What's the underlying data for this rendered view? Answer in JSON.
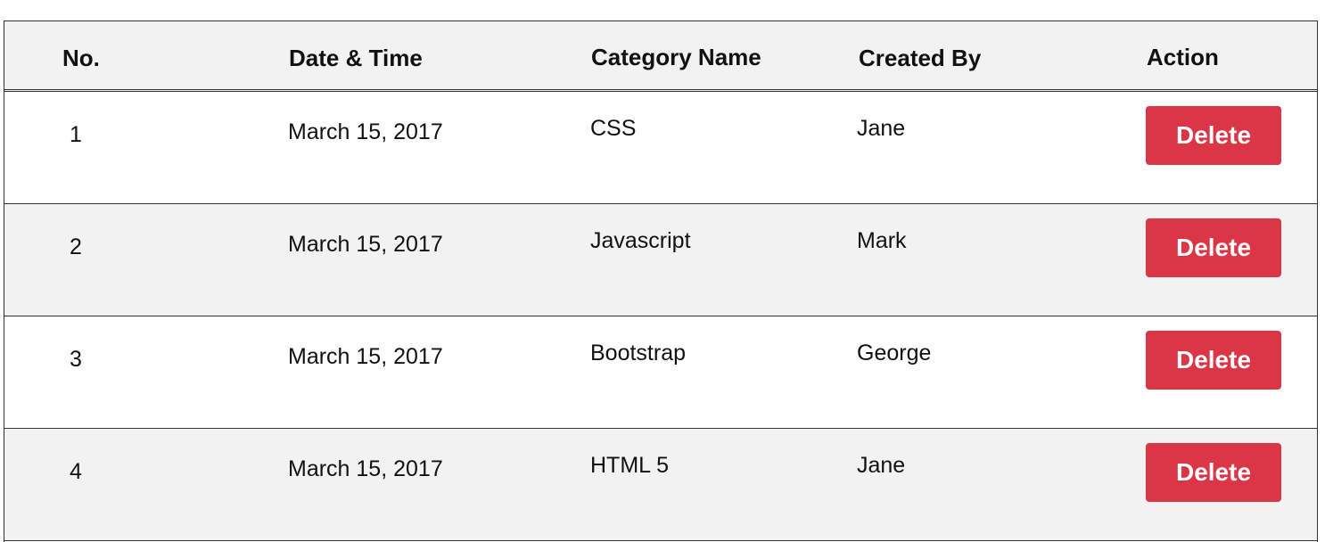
{
  "table": {
    "headers": {
      "no": "No.",
      "datetime": "Date & Time",
      "category": "Category Name",
      "created_by": "Created By",
      "action": "Action"
    },
    "rows": [
      {
        "no": "1",
        "datetime": "March 15, 2017",
        "category": "CSS",
        "created_by": "Jane",
        "action_label": "Delete"
      },
      {
        "no": "2",
        "datetime": "March 15, 2017",
        "category": "Javascript",
        "created_by": "Mark",
        "action_label": "Delete"
      },
      {
        "no": "3",
        "datetime": "March 15, 2017",
        "category": "Bootstrap",
        "created_by": "George",
        "action_label": "Delete"
      },
      {
        "no": "4",
        "datetime": "March 15, 2017",
        "category": "HTML 5",
        "created_by": "Jane",
        "action_label": "Delete"
      }
    ]
  },
  "colors": {
    "delete_button": "#dc3545",
    "alt_row_background": "#f2f2f2"
  }
}
